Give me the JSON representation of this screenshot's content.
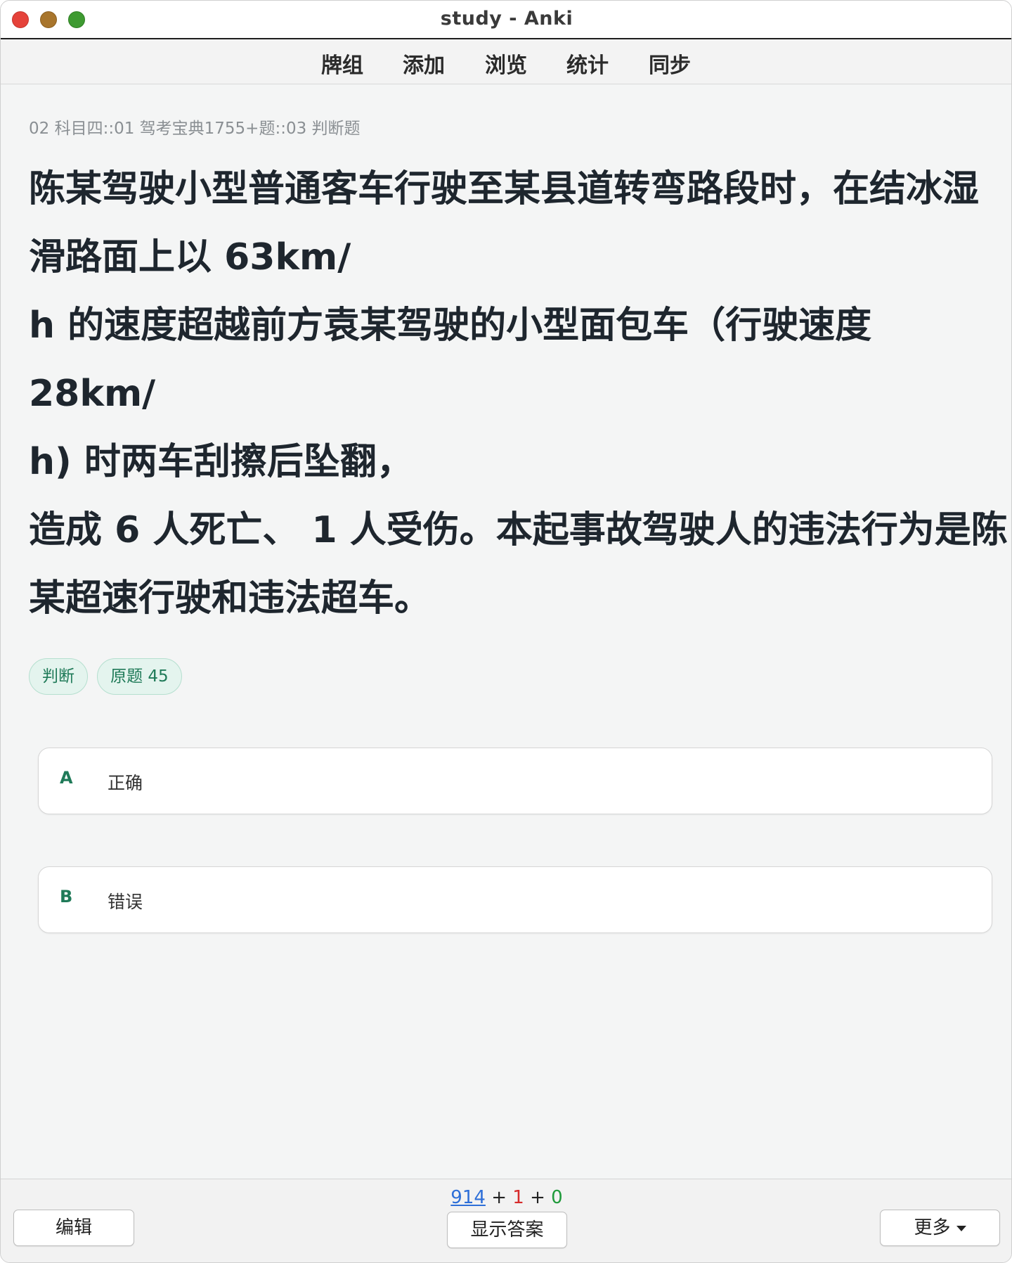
{
  "window": {
    "title": "study - Anki"
  },
  "toolbar": {
    "items": [
      {
        "label": "牌组"
      },
      {
        "label": "添加"
      },
      {
        "label": "浏览"
      },
      {
        "label": "统计"
      },
      {
        "label": "同步"
      }
    ]
  },
  "card": {
    "deck_path": "02 科目四::01 驾考宝典1755+题::03 判断题",
    "question_lines": [
      "陈某驾驶小型普通客车行驶至某县道转弯路段时，在结冰湿",
      "滑路面上以 63km/",
      "h 的速度超越前方袁某驾驶的小型面包车（行驶速度",
      "28km/",
      "h) 时两车刮擦后坠翻，",
      "造成 6 人死亡、 1 人受伤。本起事故驾驶人的违法行为是陈",
      "某超速行驶和违法超车。"
    ],
    "tags": [
      {
        "label": "判断"
      },
      {
        "label": "原题 45"
      }
    ],
    "options": [
      {
        "letter": "A",
        "text": "正确"
      },
      {
        "letter": "B",
        "text": "错误"
      }
    ]
  },
  "bottom": {
    "counts": {
      "new": "914",
      "plus1": "+",
      "learn": "1",
      "plus2": "+",
      "review": "0"
    },
    "edit_label": "编辑",
    "show_answer_label": "显示答案",
    "more_label": "更多"
  }
}
